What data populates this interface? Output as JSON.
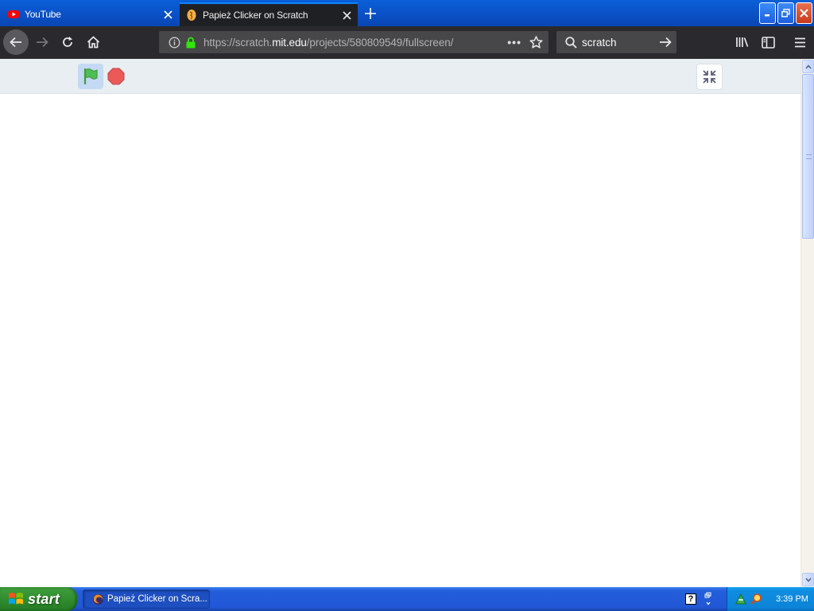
{
  "browser": {
    "tabs": [
      {
        "label": "YouTube",
        "favicon": "youtube-icon"
      },
      {
        "label": "Papież Clicker on Scratch",
        "favicon": "scratch-cat-icon",
        "active": true
      }
    ],
    "url": {
      "prefix": "https://scratch.",
      "domain": "mit.edu",
      "path": "/projects/580809549/fullscreen/"
    },
    "search": {
      "value": "scratch"
    },
    "colors": {
      "tab_active_bg": "#1f2024",
      "navbar_bg": "#2a2a2e",
      "urlbar_bg": "#474749",
      "accent": "#0a84ff"
    }
  },
  "scratch_player": {
    "green_flag": "green-flag-icon",
    "stop": "stop-sign-icon",
    "exit_fullscreen": "unfullscreen-icon",
    "colors": {
      "header_bg": "#e9eef2",
      "flag": "#4cbf56",
      "stop": "#ec5959"
    }
  },
  "taskbar": {
    "start_label": "start",
    "task": {
      "label": "Papież Clicker on Scra..."
    },
    "clock": "3:39 PM",
    "colors": {
      "taskbar": "#245edb",
      "start": "#2e8b2c",
      "tray": "#0c84d8"
    }
  }
}
